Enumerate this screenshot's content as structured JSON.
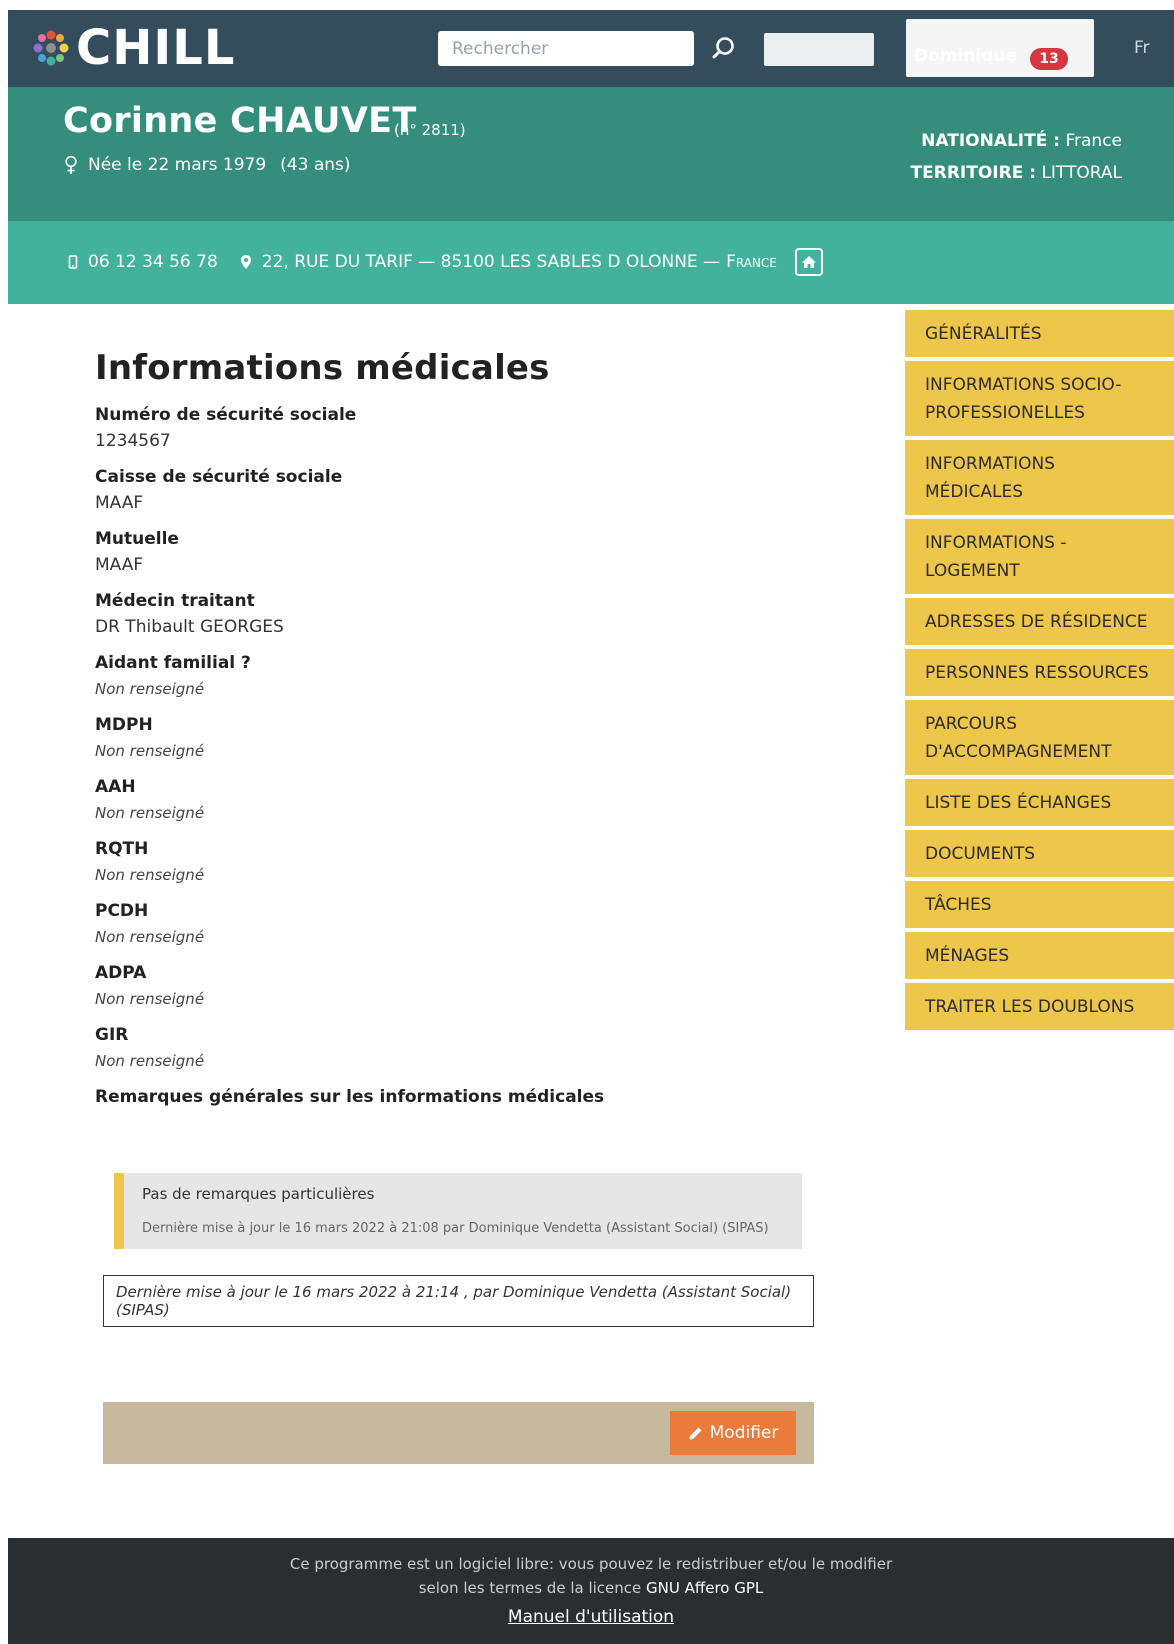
{
  "header": {
    "logo_text": "CHILL",
    "search_placeholder": "Rechercher",
    "user_name": "Dominique",
    "notification_count": "13",
    "language": "Fr"
  },
  "person": {
    "name": "Corinne CHAUVET",
    "number": "(n° 2811)",
    "birth": "Née le 22 mars 1979",
    "age": "(43 ans)",
    "nationality_label": "NATIONALITÉ :",
    "nationality_value": "France",
    "territory_label": "TERRITOIRE :",
    "territory_value": "LITTORAL",
    "phone": "06 12 34 56 78",
    "address": "22, RUE DU TARIF — 85100 LES SABLES D OLONNE —",
    "country": "France"
  },
  "menu": [
    "GÉNÉRALITÉS",
    "INFORMATIONS SOCIO-PROFESSIONELLES",
    "INFORMATIONS MÉDICALES",
    "INFORMATIONS - LOGEMENT",
    "ADRESSES DE RÉSIDENCE",
    "PERSONNES RESSOURCES",
    "PARCOURS D'ACCOMPAGNEMENT",
    "LISTE DES ÉCHANGES",
    "DOCUMENTS",
    "TÂCHES",
    "MÉNAGES",
    "TRAITER LES DOUBLONS"
  ],
  "main": {
    "title": "Informations médicales",
    "fields": [
      {
        "label": "Numéro de sécurité sociale",
        "value": "1234567"
      },
      {
        "label": "Caisse de sécurité sociale",
        "value": "MAAF"
      },
      {
        "label": "Mutuelle",
        "value": "MAAF"
      },
      {
        "label": "Médecin traitant",
        "value": "DR Thibault GEORGES"
      },
      {
        "label": "Aidant familial ?",
        "value": "Non renseigné"
      },
      {
        "label": "MDPH",
        "value": "Non renseigné"
      },
      {
        "label": "AAH",
        "value": "Non renseigné"
      },
      {
        "label": "RQTH",
        "value": "Non renseigné"
      },
      {
        "label": "PCDH",
        "value": "Non renseigné"
      },
      {
        "label": "ADPA",
        "value": "Non renseigné"
      },
      {
        "label": "GIR",
        "value": "Non renseigné"
      }
    ],
    "remarks_label": "Remarques générales sur les informations médicales",
    "remark_text": "Pas de remarques particulières",
    "remark_meta": "Dernière mise à jour le 16 mars 2022 à 21:08 par Dominique Vendetta (Assistant Social) (SIPAS)",
    "last_update": "Dernière mise à jour le 16 mars 2022 à 21:14 , par Dominique Vendetta (Assistant Social) (SIPAS)",
    "modify_label": "Modifier"
  },
  "footer": {
    "line1": "Ce programme est un logiciel libre: vous pouvez le redistribuer et/ou le modifier",
    "line2_prefix": "selon les termes de la licence",
    "license": "GNU Affero GPL",
    "manual": "Manuel d'utilisation"
  },
  "colors": {
    "navbar": "#334d5c",
    "banner_dark": "#358e7c",
    "banner_light": "#43b29d",
    "menu": "#edc64a",
    "modify": "#ea7b3a",
    "footer": "#2b2e31"
  }
}
